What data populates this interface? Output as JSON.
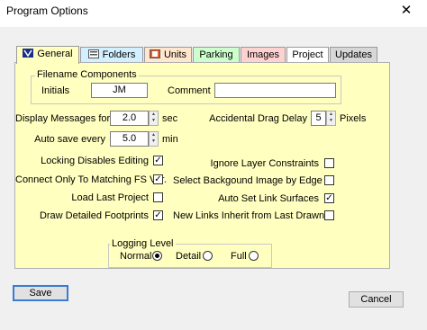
{
  "window": {
    "title": "Program Options",
    "close_glyph": "✕"
  },
  "tabs": [
    {
      "label": "General",
      "icon": "general-icon",
      "color": "#ffffc0"
    },
    {
      "label": "Folders",
      "icon": "folder-icon",
      "color": "#d2f0ff"
    },
    {
      "label": "Units",
      "icon": "units-icon",
      "color": "#ffe6cc"
    },
    {
      "label": "Parking",
      "icon": "",
      "color": "#ccffcc"
    },
    {
      "label": "Images",
      "icon": "",
      "color": "#ffd2d2"
    },
    {
      "label": "Project",
      "icon": "",
      "color": "#ffffff"
    },
    {
      "label": "Updates",
      "icon": "",
      "color": "#d7d7d7"
    }
  ],
  "filename_components": {
    "group_label": "Filename Components",
    "initials_label": "Initials",
    "initials_value": "JM",
    "comment_label": "Comment",
    "comment_value": ""
  },
  "settings": {
    "display_messages_label": "Display Messages for",
    "display_messages_value": "2.0",
    "display_messages_unit": "sec",
    "auto_save_label": "Auto save every",
    "auto_save_value": "5.0",
    "auto_save_unit": "min",
    "drag_delay_label": "Accidental Drag Delay",
    "drag_delay_value": "5",
    "drag_delay_unit": "Pixels"
  },
  "checkboxes_left": [
    {
      "label": "Locking Disables Editing",
      "checked": true,
      "mark": "✓"
    },
    {
      "label": "Connect Only To Matching FS Ver.",
      "checked": true,
      "mark": "✓"
    },
    {
      "label": "Load Last Project",
      "checked": false,
      "mark": ""
    },
    {
      "label": "Draw Detailed Footprints",
      "checked": true,
      "mark": "✓"
    }
  ],
  "checkboxes_right": [
    {
      "label": "Ignore Layer Constraints",
      "checked": false,
      "mark": ""
    },
    {
      "label": "Select Backgound Image by Edge",
      "checked": false,
      "mark": ""
    },
    {
      "label": "Auto Set Link Surfaces",
      "checked": true,
      "mark": "✓"
    },
    {
      "label": "New Links Inherit from Last Drawn",
      "checked": false,
      "mark": ""
    }
  ],
  "logging": {
    "group_label": "Logging Level",
    "options": [
      {
        "label": "Normal",
        "selected": true
      },
      {
        "label": "Detail",
        "selected": false
      },
      {
        "label": "Full",
        "selected": false
      }
    ]
  },
  "buttons": {
    "save": "Save",
    "cancel": "Cancel"
  }
}
